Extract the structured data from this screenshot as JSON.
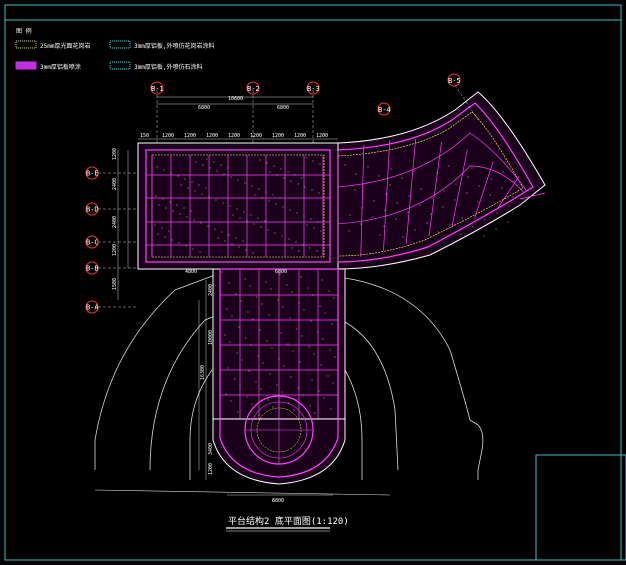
{
  "legend": {
    "heading": "图 例",
    "items": [
      {
        "label": "25mm厚光面花岗岩",
        "swatch": "#d8d840"
      },
      {
        "label": "3mm厚铝板,外喷仿花岗岩涂料",
        "swatch": "#40d8d8"
      },
      {
        "label": "3mm厚铝板喷涂",
        "swatch": "#c030e0"
      },
      {
        "label": "3mm厚铝板,外喷仿石涂料",
        "swatch": "#40d8d8"
      }
    ]
  },
  "axes_top": [
    "B-1",
    "B-2",
    "B-3"
  ],
  "axes_side": [
    "B-E",
    "B-D",
    "B-C",
    "B-B",
    "B-A"
  ],
  "axis_right": "B-5",
  "axis_right2": "B-4",
  "dims_top": [
    "6800",
    "10600",
    "6800"
  ],
  "dims_row": [
    "150",
    "1200",
    "1200",
    "1200",
    "1200",
    "1200",
    "1200",
    "1200",
    "1200"
  ],
  "dims_left": [
    "1200",
    "2400",
    "2400",
    "1200",
    "1500"
  ],
  "dims_bottom_row": [
    "4800",
    "6800"
  ],
  "dims_stem": [
    "2400",
    "10000",
    "16300",
    "3400",
    "1200"
  ],
  "dim_bottom": "6800",
  "title": "平台结构2 底平面图(1:120)",
  "colors": {
    "grid": "#ff40ff",
    "outline": "#ffffff",
    "accent": "#ffff60",
    "cyan": "#40ffff",
    "red": "#ff3030",
    "green": "#40ff40"
  }
}
